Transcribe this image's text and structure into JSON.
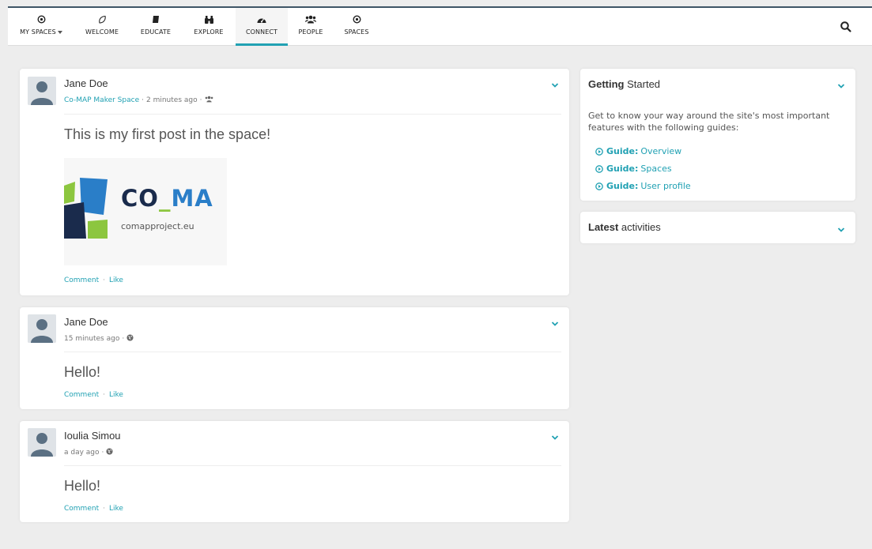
{
  "nav": {
    "items": [
      {
        "label": "MY SPACES",
        "icon": "circle-dot-icon"
      },
      {
        "label": "WELCOME",
        "icon": "leaf-icon"
      },
      {
        "label": "EDUCATE",
        "icon": "book-icon"
      },
      {
        "label": "EXPLORE",
        "icon": "binoculars-icon"
      },
      {
        "label": "CONNECT",
        "icon": "dashboard-icon"
      },
      {
        "label": "PEOPLE",
        "icon": "users-icon"
      },
      {
        "label": "SPACES",
        "icon": "circle-dot-icon"
      }
    ],
    "active": "CONNECT"
  },
  "colors": {
    "accent": "#21a1b3",
    "topline": "#3e5566",
    "logo_navy": "#1a2b4c",
    "logo_blue": "#2a7ec8",
    "logo_green": "#8cc63f"
  },
  "posts": [
    {
      "author": "Jane Doe",
      "space": "Co-MAP Maker Space",
      "time": "2 minutes ago",
      "visibility_icon": "users-icon",
      "text": "This is my first post in the space!",
      "image": {
        "logo_text": "CO_MA",
        "logo_text_green": "_",
        "domain": "comapproject.eu"
      },
      "comment_label": "Comment",
      "like_label": "Like"
    },
    {
      "author": "Jane Doe",
      "time": "15 minutes ago",
      "visibility_icon": "globe-icon",
      "text": "Hello!",
      "comment_label": "Comment",
      "like_label": "Like"
    },
    {
      "author": "Ioulia Simou",
      "time": "a day ago",
      "visibility_icon": "globe-icon",
      "text": "Hello!",
      "comment_label": "Comment",
      "like_label": "Like"
    }
  ],
  "getting_started": {
    "title_bold": "Getting",
    "title_rest": "Started",
    "intro": "Get to know your way around the site's most important features with the following guides:",
    "guides": [
      {
        "prefix": "Guide:",
        "label": "Overview"
      },
      {
        "prefix": "Guide:",
        "label": "Spaces"
      },
      {
        "prefix": "Guide:",
        "label": "User profile"
      }
    ]
  },
  "latest_activities": {
    "title_bold": "Latest",
    "title_rest": "activities"
  },
  "meta_separator": "·",
  "action_separator": "·"
}
